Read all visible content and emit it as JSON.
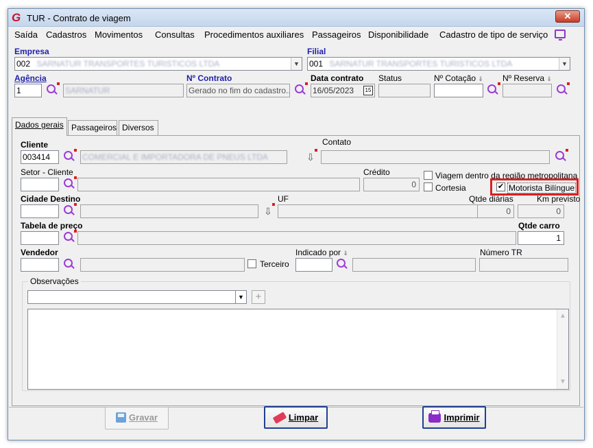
{
  "window": {
    "title": "TUR - Contrato de viagem",
    "close_label": "✕",
    "app_icon": "G"
  },
  "menu": {
    "items": [
      "Saída",
      "Cadastros",
      "Movimentos",
      "Consultas",
      "Procedimentos auxiliares",
      "Passageiros",
      "Disponibilidade",
      "Cadastro de tipo de serviço"
    ],
    "trailing_icon": "monitor-icon"
  },
  "header": {
    "empresa_label": "Empresa",
    "empresa_code": "002",
    "empresa_name": "SARNATUR TRANSPORTES TURISTICOS LTDA",
    "filial_label": "Filial",
    "filial_code": "001",
    "filial_name": "SARNATUR TRANSPORTES TURISTICOS LTDA",
    "agencia_label": "Agência",
    "agencia_code": "1",
    "agencia_name": "SARNATUR",
    "contrato_label": "Nº Contrato",
    "contrato_placeholder": "Gerado no fim do cadastro...",
    "data_label": "Data contrato",
    "data_value": "16/05/2023",
    "calendar_glyph": "15",
    "status_label": "Status",
    "cotacao_label": "Nº Cotação",
    "reserva_label": "Nº Reserva"
  },
  "tabs": [
    {
      "label": "Dados gerais",
      "active": true
    },
    {
      "label": "Passageiros",
      "active": false
    },
    {
      "label": "Diversos",
      "active": false
    }
  ],
  "form": {
    "cliente_label": "Cliente",
    "cliente_code": "003414",
    "cliente_name": "COMERCIAL E IMPORTADORA DE PNEUS LTDA",
    "contato_label": "Contato",
    "setor_label": "Setor - Cliente",
    "credito_label": "Crédito",
    "credito_value": "0",
    "viagem_label": "Viagem dentro da região metropolitana",
    "viagem_checked": false,
    "cortesia_label": "Cortesia",
    "cortesia_checked": false,
    "motorista_label": "Motorista Bilíngue",
    "motorista_checked": true,
    "cidade_label": "Cidade Destino",
    "uf_label": "UF",
    "qtde_diarias_label": "Qtde diárias",
    "qtde_diarias_value": "0",
    "km_label": "Km previsto",
    "km_value": "0",
    "tabela_label": "Tabela de preço",
    "qtde_carro_label": "Qtde carro",
    "qtde_carro_value": "1",
    "vendedor_label": "Vendedor",
    "terceiro_label": "Terceiro",
    "terceiro_checked": false,
    "indicado_label": "Indicado por",
    "numero_tr_label": "Número TR",
    "observacoes_label": "Observações",
    "plus_label": "+"
  },
  "buttons": {
    "gravar": "Gravar",
    "limpar": "Limpar",
    "imprimir": "Imprimir"
  },
  "colors": {
    "accent_purple": "#9b3bd6",
    "label_blue": "#1f1fa8",
    "highlight_red": "#d72121"
  }
}
